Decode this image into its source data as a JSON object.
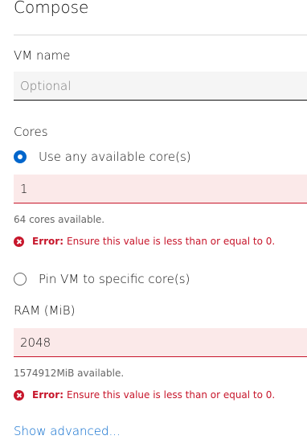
{
  "form": {
    "title": "Compose",
    "vm_name": {
      "label": "VM name",
      "placeholder": "Optional",
      "value": ""
    },
    "cores": {
      "label": "Cores",
      "option_any": "Use any available core(s)",
      "option_any_selected": true,
      "value": "1",
      "help": "64 cores available.",
      "error_prefix": "Error:",
      "error_message": "Ensure this value is less than or equal to 0.",
      "option_pin": "Pin VM to specific core(s)"
    },
    "ram": {
      "label": "RAM (MiB)",
      "value": "2048",
      "help": "1574912MiB available.",
      "error_prefix": "Error:",
      "error_message": "Ensure this value is less than or equal to 0."
    },
    "show_advanced": "Show advanced..."
  },
  "colors": {
    "accent": "#0066cc",
    "error": "#c7162b",
    "error_bg": "#fbe9e9"
  },
  "icons": {
    "error": "error-icon",
    "radio": "radio-icon"
  }
}
